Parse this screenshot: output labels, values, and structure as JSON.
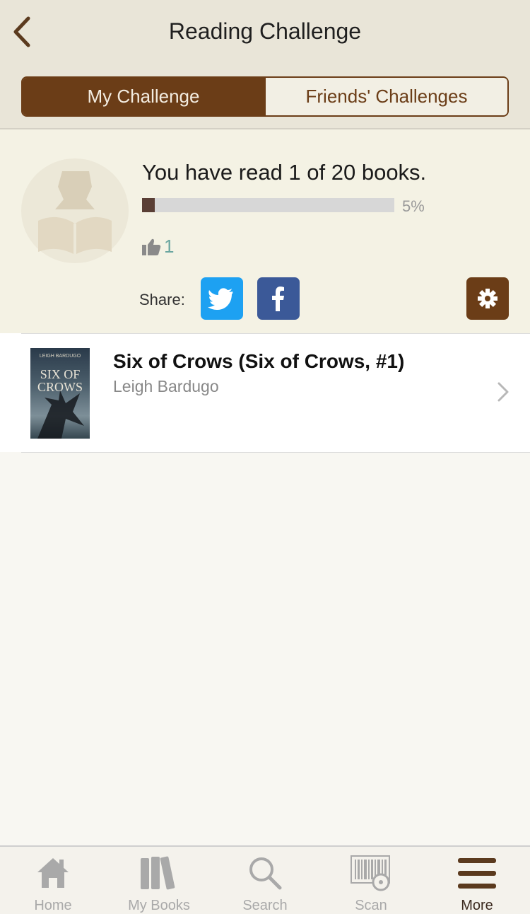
{
  "header": {
    "title": "Reading Challenge",
    "back_icon": "chevron-left-icon"
  },
  "segments": [
    {
      "label": "My Challenge",
      "selected": true
    },
    {
      "label": "Friends' Challenges",
      "selected": false
    }
  ],
  "challenge": {
    "read_text": "You have read 1 of 20 books.",
    "progress_fraction": 0.05,
    "percent_text": "5%",
    "likes": "1",
    "share_label": "Share:"
  },
  "book": {
    "title": "Six of Crows (Six of Crows, #1)",
    "author": "Leigh Bardugo",
    "cover_title": "SIX OF CROWS",
    "cover_author": "LEIGH BARDUGO"
  },
  "tabbar": {
    "items": [
      {
        "label": "Home",
        "icon": "home-icon"
      },
      {
        "label": "My Books",
        "icon": "books-icon"
      },
      {
        "label": "Search",
        "icon": "search-icon"
      },
      {
        "label": "Scan",
        "icon": "barcode-scan-icon"
      },
      {
        "label": "More",
        "icon": "menu-icon",
        "active": true
      }
    ]
  },
  "colors": {
    "brand_brown": "#6b3d17",
    "twitter": "#1da1f2",
    "facebook": "#3b5998"
  }
}
